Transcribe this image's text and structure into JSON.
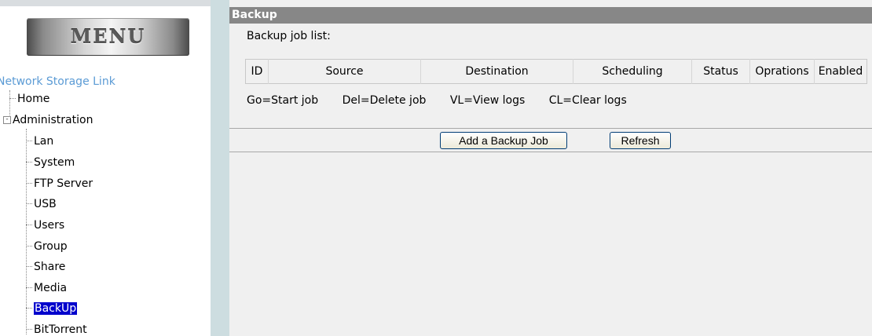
{
  "menu": {
    "title": "MENU",
    "root": "Network Storage Link",
    "items": [
      {
        "label": "Home",
        "level": 0,
        "expander": false,
        "selected": false
      },
      {
        "label": "Administration",
        "level": 0,
        "expander": true,
        "expander_symbol": "-",
        "selected": false
      },
      {
        "label": "Lan",
        "level": 1,
        "selected": false
      },
      {
        "label": "System",
        "level": 1,
        "selected": false
      },
      {
        "label": "FTP Server",
        "level": 1,
        "selected": false
      },
      {
        "label": "USB",
        "level": 1,
        "selected": false
      },
      {
        "label": "Users",
        "level": 1,
        "selected": false
      },
      {
        "label": "Group",
        "level": 1,
        "selected": false
      },
      {
        "label": "Share",
        "level": 1,
        "selected": false
      },
      {
        "label": "Media",
        "level": 1,
        "selected": false
      },
      {
        "label": "BackUp",
        "level": 1,
        "selected": true
      },
      {
        "label": "BitTorrent",
        "level": 1,
        "selected": false
      }
    ]
  },
  "content": {
    "section_title": "Backup",
    "job_list_label": "Backup job list:",
    "table_headers": [
      "ID",
      "Source",
      "Destination",
      "Scheduling",
      "Status",
      "Oprations",
      "Enabled"
    ],
    "legend": [
      "Go=Start job",
      "Del=Delete job",
      "VL=View logs",
      "CL=Clear logs"
    ],
    "buttons": {
      "add": "Add a Backup Job",
      "refresh": "Refresh"
    }
  },
  "colors": {
    "header_bg": "#878787",
    "selected_bg": "#0000cc",
    "root_link": "#5b9bd5",
    "divider": "#cddde0"
  }
}
